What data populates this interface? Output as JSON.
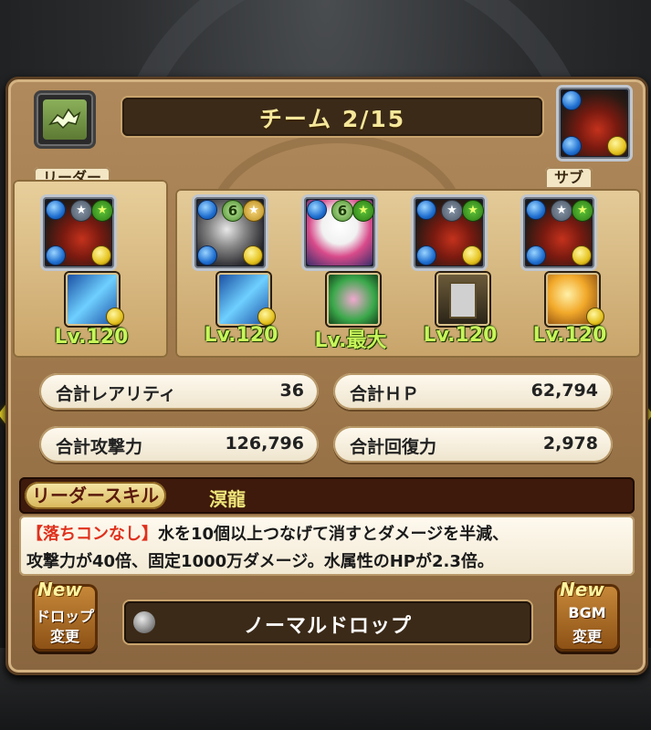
{
  "team": {
    "title": "チーム 2/15"
  },
  "labels": {
    "leader": "リーダー",
    "sub": "サブ"
  },
  "levels": [
    "Lv.120",
    "Lv.120",
    "Lv.最大",
    "Lv.120",
    "Lv.120"
  ],
  "awakenings": {
    "num_a": "6",
    "num_b": "6"
  },
  "stats": {
    "rarity_label": "合計レアリティ",
    "rarity_value": "36",
    "hp_label": "合計ＨＰ",
    "hp_value": "62,794",
    "atk_label": "合計攻撃力",
    "atk_value": "126,796",
    "rcv_label": "合計回復力",
    "rcv_value": "2,978"
  },
  "leader_skill": {
    "label": "リーダースキル",
    "name": "溟龍",
    "highlight": "【落ちコンなし】",
    "text1": "水を10個以上つなげて消すとダメージを半減、",
    "text2": "攻撃力が40倍、固定1000万ダメージ。水属性のHPが2.3倍。"
  },
  "buttons": {
    "drop_new": "New",
    "drop_t1": "ドロップ",
    "drop_t2": "変更",
    "bgm_new": "New",
    "bgm_t1": "BGM",
    "bgm_t2": "変更",
    "drop_name": "ノーマルドロップ"
  },
  "colors": {
    "accent": "#e8d22a",
    "level": "#c7f55a",
    "highlight": "#e0301c"
  }
}
